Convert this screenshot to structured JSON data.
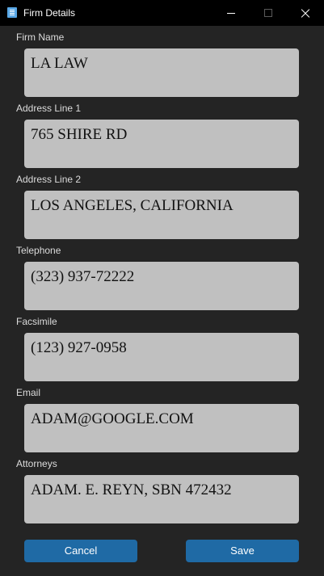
{
  "window": {
    "title": "Firm Details"
  },
  "fields": [
    {
      "label": "Firm Name",
      "value": "LA LAW"
    },
    {
      "label": "Address Line 1",
      "value": "765 SHIRE RD"
    },
    {
      "label": "Address Line 2",
      "value": "LOS ANGELES, CALIFORNIA"
    },
    {
      "label": "Telephone",
      "value": "(323) 937-72222"
    },
    {
      "label": "Facsimile",
      "value": "(123) 927-0958"
    },
    {
      "label": "Email",
      "value": "ADAM@GOOGLE.COM"
    },
    {
      "label": "Attorneys",
      "value": "ADAM. E. REYN, SBN 472432"
    }
  ],
  "buttons": {
    "cancel_label": "Cancel",
    "save_label": "Save"
  },
  "colors": {
    "background": "#242424",
    "titlebar": "#000000",
    "field_bg": "#c0c0c0",
    "button_bg": "#1f6aa5"
  }
}
